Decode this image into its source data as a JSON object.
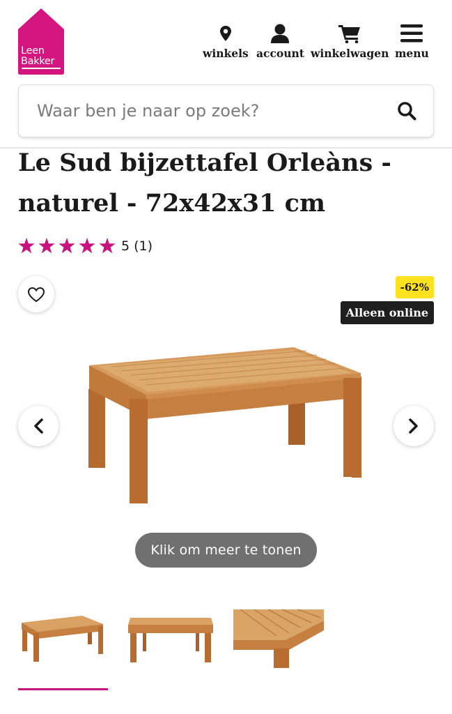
{
  "brand": {
    "name_line1": "Leen",
    "name_line2": "Bakker",
    "color": "#d4157f"
  },
  "nav": {
    "items": [
      {
        "label": "winkels",
        "icon": "location-pin-icon"
      },
      {
        "label": "account",
        "icon": "user-icon"
      },
      {
        "label": "winkelwagen",
        "icon": "cart-icon"
      },
      {
        "label": "menu",
        "icon": "hamburger-icon"
      }
    ]
  },
  "search": {
    "placeholder": "Waar ben je naar op zoek?",
    "value": "",
    "icon": "search-icon"
  },
  "product": {
    "title": "Le Sud bijzettafel Orleàns - naturel - 72x42x31 cm",
    "rating_value": 5,
    "rating_max": 5,
    "rating_text": "5 (1)",
    "star_color": "#c8127e",
    "discount_badge": "-62%",
    "online_badge": "Alleen online",
    "show_more_label": "Klik om meer te tonen"
  },
  "gallery": {
    "thumbnail_count": 3,
    "active_index": 0,
    "accent_color": "#c8127e"
  }
}
